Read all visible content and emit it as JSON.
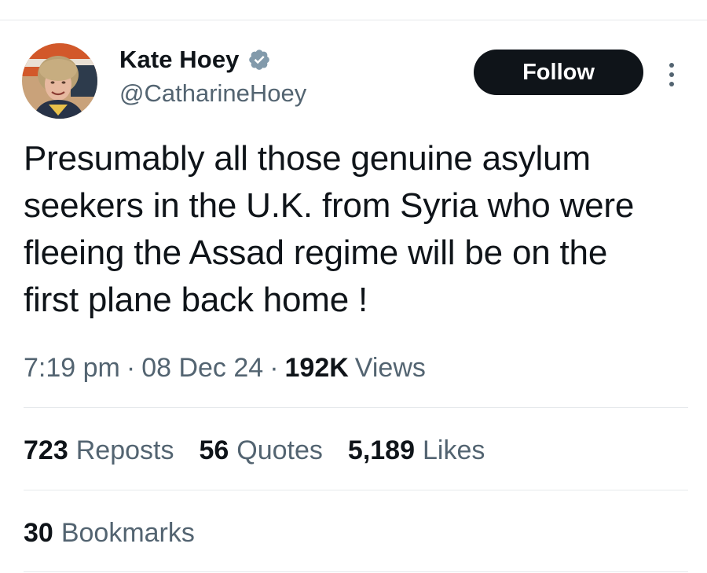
{
  "author": {
    "name": "Kate Hoey",
    "handle": "@CatharineHoey",
    "verified_icon": "verified-badge-icon",
    "verified_color": "#829aab"
  },
  "follow_button": {
    "label": "Follow",
    "background": "#0f1419",
    "color": "#ffffff"
  },
  "more_icon": "vertical-ellipsis-icon",
  "tweet": {
    "text": "Presumably all those genuine asylum\nseekers in the U.K. from Syria who were\nfleeing the Assad regime will be on the\nfirst plane back home !"
  },
  "meta": {
    "time": "7:19 pm",
    "separator": "·",
    "date": "08 Dec 24",
    "views_count": "192K",
    "views_label": "Views"
  },
  "stats": {
    "reposts": {
      "count": "723",
      "label": "Reposts"
    },
    "quotes": {
      "count": "56",
      "label": "Quotes"
    },
    "likes": {
      "count": "5,189",
      "label": "Likes"
    },
    "bookmarks": {
      "count": "30",
      "label": "Bookmarks"
    }
  },
  "colors": {
    "text_primary": "#0f1419",
    "text_secondary": "#536471",
    "divider": "#e6e9ec"
  }
}
